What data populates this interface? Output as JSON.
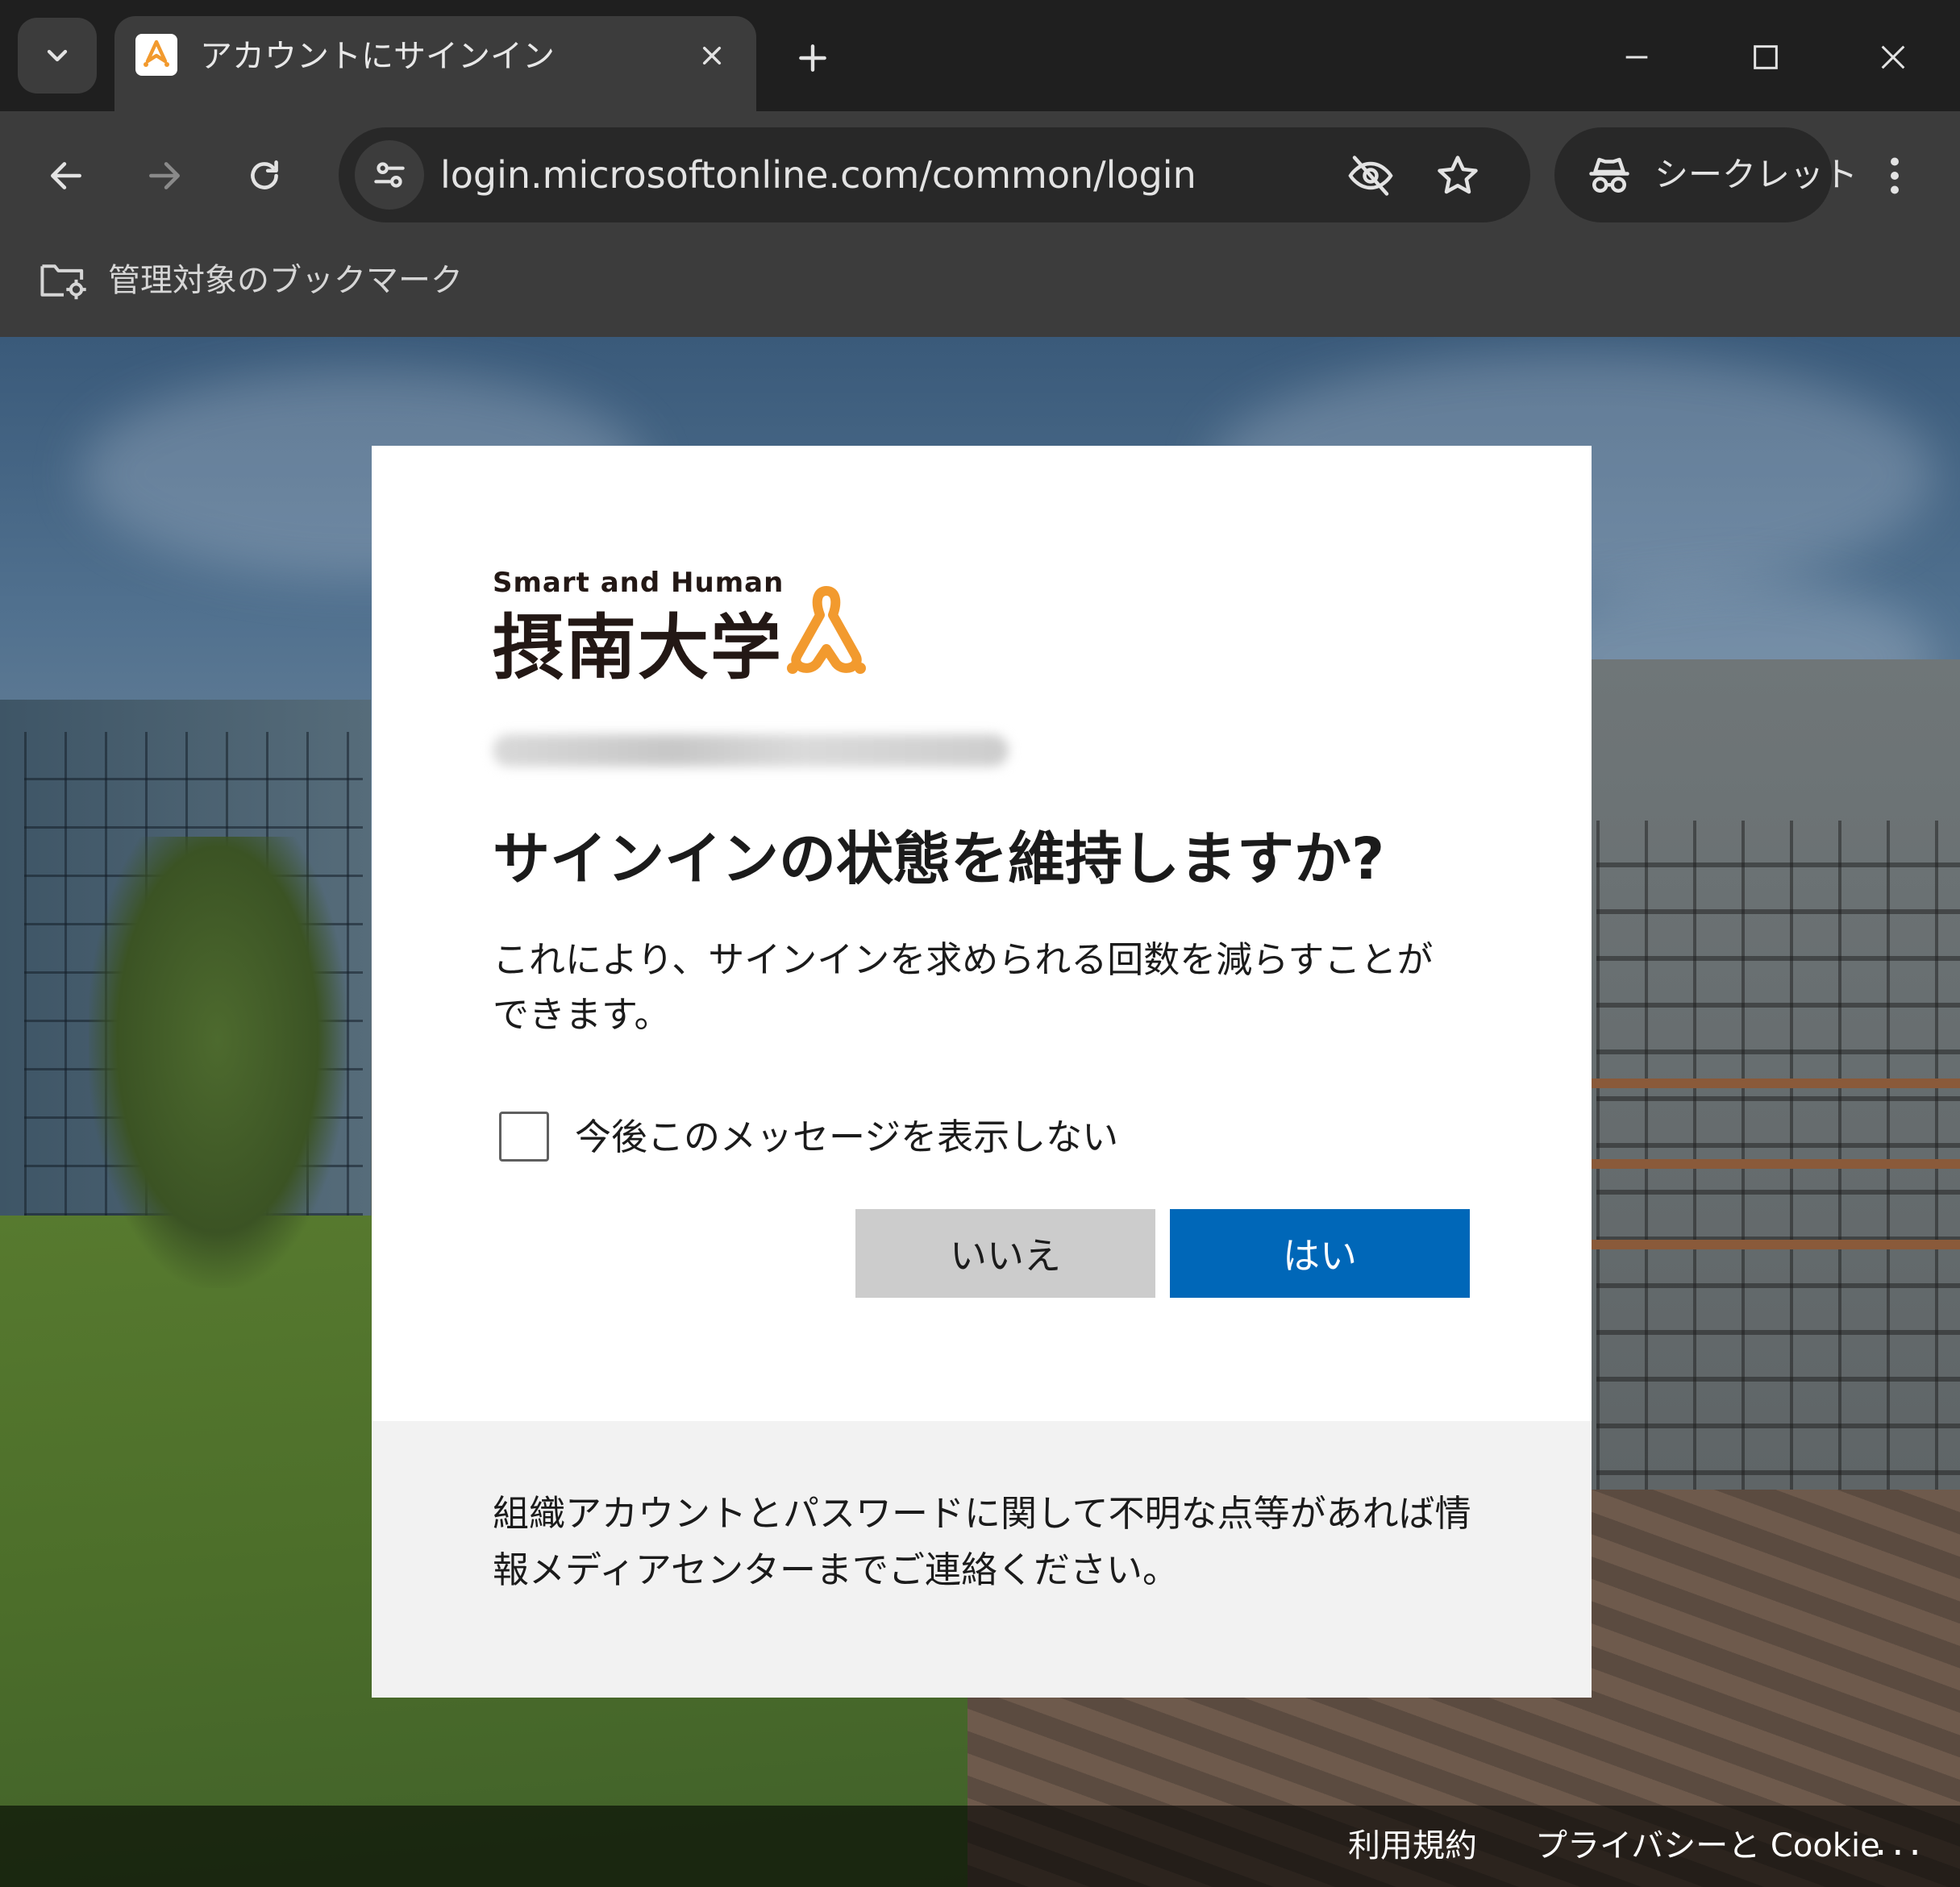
{
  "browser": {
    "tab": {
      "title": "アカウントにサインイン",
      "favicon": "setsunan-logo-icon"
    },
    "icons": {
      "tab_search": "chevron-down-icon",
      "tab_close": "close-icon",
      "new_tab": "plus-icon",
      "minimize": "minimize-icon",
      "maximize": "maximize-icon",
      "close": "close-icon",
      "back": "arrow-left-icon",
      "forward": "arrow-right-icon",
      "reload": "reload-icon",
      "site_info": "tune-icon",
      "tracking": "eye-off-icon",
      "bookmark": "star-icon",
      "menu": "more-vertical-icon",
      "managed_bookmarks": "managed-folder-icon"
    },
    "address_bar": {
      "url": "login.microsoftonline.com/common/login"
    },
    "incognito_label": "シークレット",
    "bookmarks_bar": {
      "managed_label": "管理対象のブックマーク"
    }
  },
  "dialog": {
    "logo": {
      "tagline": "Smart and Human",
      "name": "摂南大学",
      "accent_color": "#f29a2e"
    },
    "title": "サインインの状態を維持しますか?",
    "description": "これにより、サインインを求められる回数を減らすことができます。",
    "checkbox": {
      "label": "今後このメッセージを表示しない",
      "checked": false
    },
    "buttons": {
      "no": "いいえ",
      "yes": "はい"
    },
    "footer_text": "組織アカウントとパスワードに関して不明な点等があれば情報メディアセンターまでご連絡ください。",
    "primary_color": "#0067b8"
  },
  "page_footer": {
    "terms": "利用規約",
    "privacy": "プライバシーと Cookie",
    "more": "..."
  }
}
